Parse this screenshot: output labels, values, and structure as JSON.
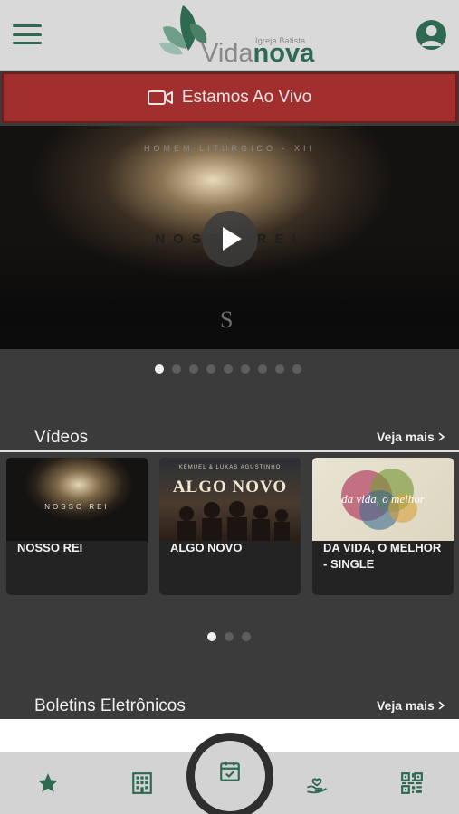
{
  "header": {
    "logo": {
      "small_text": "Igreja Batista",
      "main_part1": "Vida",
      "main_part2": "nova"
    },
    "menu_icon": "hamburger-menu-icon",
    "profile_icon": "account-circle-icon"
  },
  "live_banner": {
    "label": "Estamos Ao Vivo",
    "icon": "video-camera-icon"
  },
  "hero": {
    "subtitle": "HOMEM LITÚRGICO - XII",
    "title": "NOSSO REI",
    "mark": "S",
    "play_icon": "play-icon",
    "dots_total": 9,
    "active_dot": 0
  },
  "videos_section": {
    "title": "Vídeos",
    "see_more": "Veja mais",
    "cards": [
      {
        "label": "NOSSO REI",
        "thumb_text": "NOSSO REI"
      },
      {
        "label": "ALGO NOVO",
        "thumb_text": "ALGO NOVO",
        "thumb_subtext": "KEMUEL & LUKAS AGUSTINHO"
      },
      {
        "label": "DA VIDA, O MELHOR - SINGLE",
        "thumb_text": "da vida, o melhor"
      }
    ],
    "dots_total": 3,
    "active_dot": 0
  },
  "bulletins_section": {
    "title": "Boletins Eletrônicos",
    "see_more": "Veja mais"
  },
  "bottom_nav": {
    "items": [
      "star-icon",
      "building-icon",
      "calendar-check-icon",
      "hand-heart-icon",
      "qr-code-icon"
    ]
  },
  "colors": {
    "brand_green": "#2e6a52",
    "live_red": "#a02f2e",
    "background": "#3b3b3b"
  }
}
